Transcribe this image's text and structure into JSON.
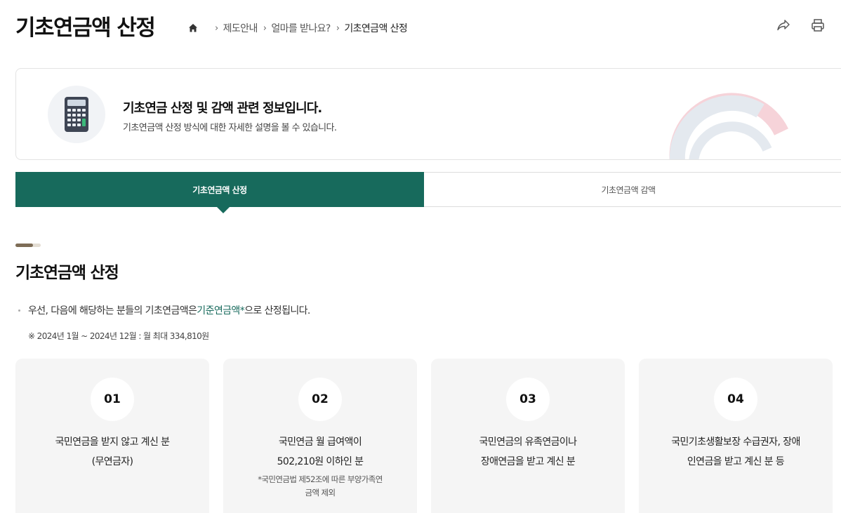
{
  "header": {
    "title": "기초연금액 산정",
    "breadcrumb": [
      "제도안내",
      "얼마를 받나요?",
      "기초연금액 산정"
    ],
    "share_label": "공유",
    "print_label": "인쇄"
  },
  "info": {
    "title": "기초연금 산정 및 감액 관련 정보입니다.",
    "description": "기초연금액 산정 방식에 대한 자세한 설명을 볼 수 있습니다."
  },
  "tabs": [
    {
      "label": "기초연금액 산정",
      "active": true
    },
    {
      "label": "기초연금액 감액",
      "active": false
    }
  ],
  "section": {
    "title": "기초연금액 산정",
    "intro_before": "우선, 다음에 해당하는 분들의 기초연금액은 ",
    "intro_highlight": "기준연금액*",
    "intro_after": "으로 산정됩니다.",
    "note": "※ 2024년 1월 ~ 2024년 12월 : 월 최대 334,810원"
  },
  "cards": [
    {
      "num": "01",
      "text": "국민연금을 받지 않고 계신 분\n(무연금자)",
      "sub": ""
    },
    {
      "num": "02",
      "text": "국민연금 월 급여액이\n502,210원 이하인 분",
      "sub": "*국민연금법 제52조에 따른 부양가족연\n금액 제외"
    },
    {
      "num": "03",
      "text": "국민연금의 유족연금이나\n장애연금을 받고 계신 분",
      "sub": ""
    },
    {
      "num": "04",
      "text": "국민기초생활보장 수급권자, 장애\n인연금을 받고 계신 분 등",
      "sub": ""
    }
  ],
  "colors": {
    "accent": "#176a5c",
    "card_bg": "#f5f5f5",
    "deco": "#7e6d57"
  },
  "icons": [
    "home-icon",
    "share-icon",
    "print-icon",
    "calculator-icon",
    "emblem-icon"
  ]
}
